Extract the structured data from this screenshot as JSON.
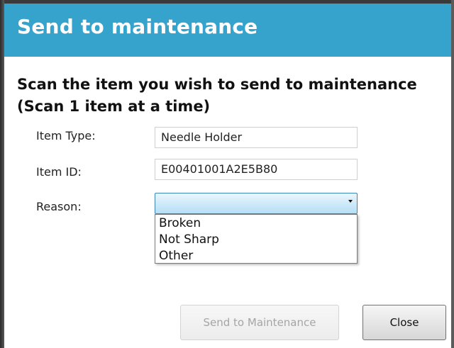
{
  "dialog": {
    "title": "Send to maintenance",
    "instruction_line1": "Scan the item you wish to send to maintenance",
    "instruction_line2": "(Scan 1 item at a time)"
  },
  "form": {
    "item_type": {
      "label": "Item Type:",
      "value": "Needle Holder"
    },
    "item_id": {
      "label": "Item ID:",
      "value": "E00401001A2E5B80"
    },
    "reason": {
      "label": "Reason:",
      "selected": "",
      "options": [
        "Broken",
        "Not Sharp",
        "Other"
      ]
    }
  },
  "buttons": {
    "send_label": "Send to Maintenance",
    "close_label": "Close"
  },
  "colors": {
    "titlebar": "#35a3cc",
    "title_text": "#ffffff",
    "combo_focus": "#3d86b8"
  }
}
